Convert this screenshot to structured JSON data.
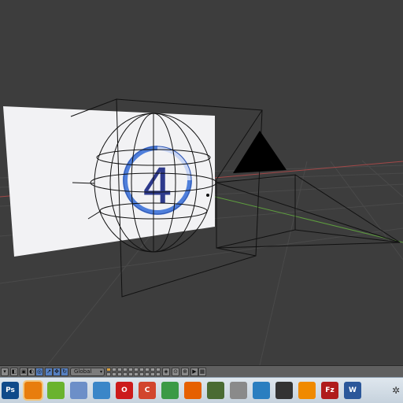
{
  "scene": {
    "countdown_number": "4",
    "colors": {
      "background": "#3d3d3d",
      "grid": "#4a4a4a",
      "x_axis": "#a24848",
      "y_axis": "#5e9e3e",
      "wire": "#111111",
      "plane": "#f2f2f4",
      "countdown": "#2e3a8c",
      "countdown_ring": "#4f7fdb",
      "camera_triangle": "#000000"
    }
  },
  "view_header": {
    "transform_orientation": "Global",
    "icons": [
      "view-menu-icon",
      "select-menu-icon",
      "object-mode-icon",
      "shading-icon",
      "pivot-icon",
      "manipulator-icon",
      "translate-icon",
      "rotate-icon",
      "scale-icon",
      "snap-icon",
      "render-preview-icon"
    ]
  },
  "taskbar": {
    "apps": [
      {
        "name": "photoshop-icon",
        "label": "Ps",
        "color": "#0f4a8a"
      },
      {
        "name": "blender-icon",
        "label": "",
        "color": "#e87d0d",
        "active": true
      },
      {
        "name": "nvidia-icon",
        "label": "",
        "color": "#6ab32e"
      },
      {
        "name": "notepad-icon",
        "label": "",
        "color": "#6c8fc8"
      },
      {
        "name": "car-app-icon",
        "label": "",
        "color": "#3a86c8"
      },
      {
        "name": "opera-icon",
        "label": "O",
        "color": "#cc1b1b"
      },
      {
        "name": "ccleaner-icon",
        "label": "C",
        "color": "#d2452d"
      },
      {
        "name": "chrome-icon",
        "label": "",
        "color": "#3b9a46"
      },
      {
        "name": "firefox-icon",
        "label": "",
        "color": "#e66000"
      },
      {
        "name": "screen-recorder-icon",
        "label": "",
        "color": "#4a6b33"
      },
      {
        "name": "skype-like-icon",
        "label": "",
        "color": "#8a8a8a"
      },
      {
        "name": "steam-icon",
        "label": "",
        "color": "#2a7ec0"
      },
      {
        "name": "mouse-icon",
        "label": "",
        "color": "#333333"
      },
      {
        "name": "vlc-icon",
        "label": "",
        "color": "#f08a00"
      },
      {
        "name": "filezilla-icon",
        "label": "Fz",
        "color": "#b01c1c"
      },
      {
        "name": "word-icon",
        "label": "W",
        "color": "#2b579a"
      }
    ]
  }
}
